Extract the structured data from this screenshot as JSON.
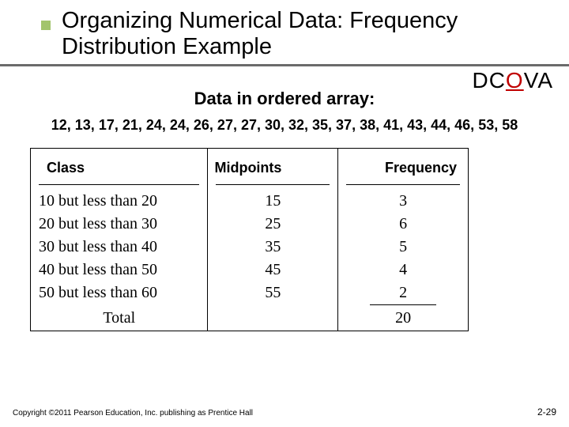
{
  "title": "Organizing Numerical Data: Frequency Distribution Example",
  "dcova": {
    "d": "D",
    "c": "C",
    "o": "O",
    "v": "V",
    "a": "A"
  },
  "subhead": "Data in ordered array:",
  "ordered_array": "12, 13, 17, 21, 24, 24, 26, 27, 27, 30, 32, 35, 37, 38, 41, 43, 44, 46, 53, 58",
  "headers": {
    "class": "Class",
    "midpoints": "Midpoints",
    "frequency": "Frequency"
  },
  "rows": [
    {
      "class": "10 but less than 20",
      "midpoint": "15",
      "frequency": "3"
    },
    {
      "class": "20 but less than 30",
      "midpoint": "25",
      "frequency": "6"
    },
    {
      "class": "30 but less than 40",
      "midpoint": "35",
      "frequency": "5"
    },
    {
      "class": "40 but less than 50",
      "midpoint": "45",
      "frequency": "4"
    },
    {
      "class": "50 but less than 60",
      "midpoint": "55",
      "frequency": "2"
    }
  ],
  "total": {
    "label": "Total",
    "frequency": "20"
  },
  "footer": {
    "copyright": "Copyright ©2011 Pearson Education, Inc. publishing as Prentice Hall",
    "page": "2-29"
  },
  "chart_data": {
    "type": "table",
    "title": "Frequency Distribution",
    "columns": [
      "Class",
      "Midpoints",
      "Frequency"
    ],
    "rows": [
      [
        "10 but less than 20",
        15,
        3
      ],
      [
        "20 but less than 30",
        25,
        6
      ],
      [
        "30 but less than 40",
        35,
        5
      ],
      [
        "40 but less than 50",
        45,
        4
      ],
      [
        "50 but less than 60",
        55,
        2
      ]
    ],
    "total_frequency": 20,
    "ordered_array": [
      12,
      13,
      17,
      21,
      24,
      24,
      26,
      27,
      27,
      30,
      32,
      35,
      37,
      38,
      41,
      43,
      44,
      46,
      53,
      58
    ]
  }
}
